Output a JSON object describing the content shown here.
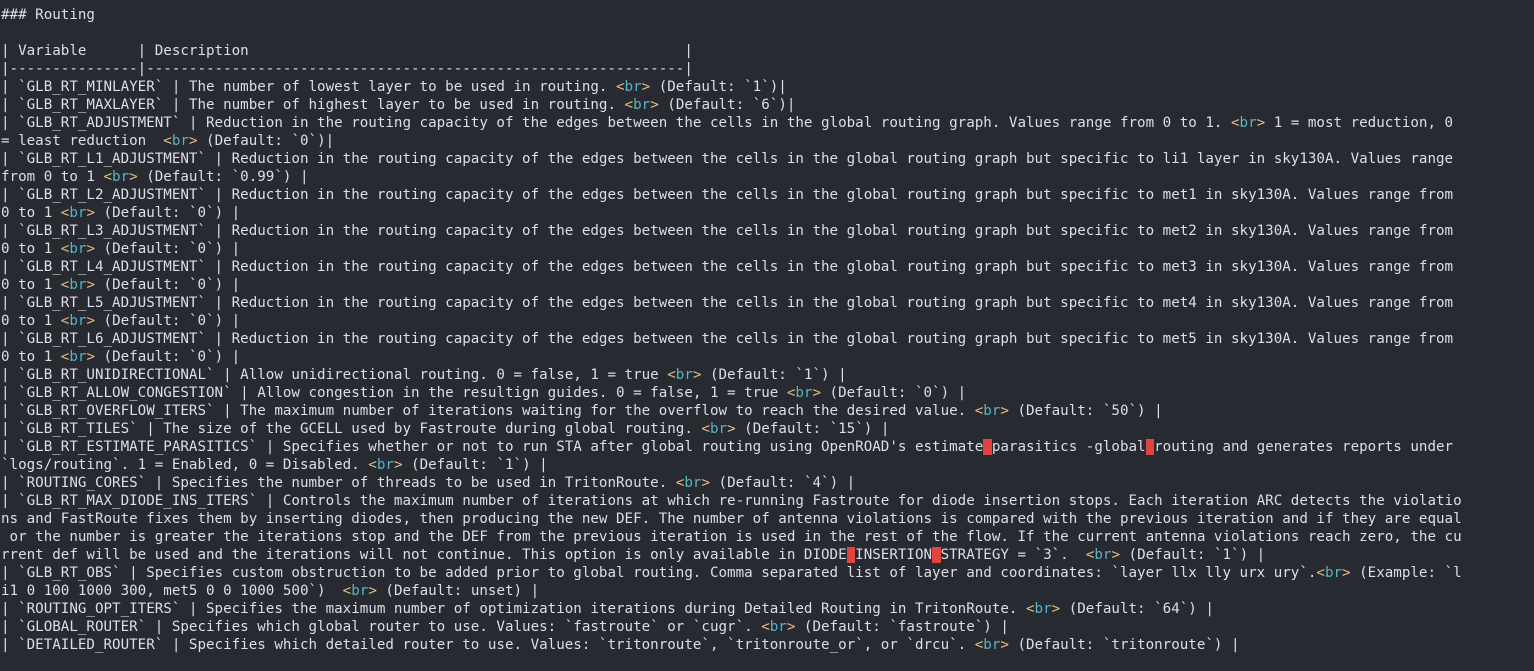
{
  "editor": {
    "background": "#272a30",
    "text_color": "#dcdfe4",
    "tag_color": "#56b6c2",
    "bracket_color": "#e5c07b",
    "highlight_color": "#e0443c"
  },
  "lines": [
    [
      {
        "t": "### Routing"
      }
    ],
    [
      {
        "t": ""
      }
    ],
    [
      {
        "t": "| Variable      | Description                                                   |"
      }
    ],
    [
      {
        "t": "|---------------|---------------------------------------------------------------|"
      }
    ],
    [
      {
        "t": "| `GLB_RT_MINLAYER` | The number of lowest layer to be used in routing. "
      },
      {
        "t": "<br>",
        "c": "br"
      },
      {
        "t": " (Default: `1`)|"
      }
    ],
    [
      {
        "t": "| `GLB_RT_MAXLAYER` | The number of highest layer to be used in routing. "
      },
      {
        "t": "<br>",
        "c": "br"
      },
      {
        "t": " (Default: `6`)|"
      }
    ],
    [
      {
        "t": "| `GLB_RT_ADJUSTMENT` | Reduction in the routing capacity of the edges between the cells in the global routing graph. Values range from 0 to 1. "
      },
      {
        "t": "<br>",
        "c": "br"
      },
      {
        "t": " 1 = most reduction, 0"
      }
    ],
    [
      {
        "t": "= least reduction  "
      },
      {
        "t": "<br>",
        "c": "br"
      },
      {
        "t": " (Default: `0`)|"
      }
    ],
    [
      {
        "t": "| `GLB_RT_L1_ADJUSTMENT` | Reduction in the routing capacity of the edges between the cells in the global routing graph but specific to li1 layer in sky130A. Values range"
      }
    ],
    [
      {
        "t": "from 0 to 1 "
      },
      {
        "t": "<br>",
        "c": "br"
      },
      {
        "t": " (Default: `0.99`) |"
      }
    ],
    [
      {
        "t": "| `GLB_RT_L2_ADJUSTMENT` | Reduction in the routing capacity of the edges between the cells in the global routing graph but specific to met1 in sky130A. Values range from"
      }
    ],
    [
      {
        "t": "0 to 1 "
      },
      {
        "t": "<br>",
        "c": "br"
      },
      {
        "t": " (Default: `0`) |"
      }
    ],
    [
      {
        "t": "| `GLB_RT_L3_ADJUSTMENT` | Reduction in the routing capacity of the edges between the cells in the global routing graph but specific to met2 in sky130A. Values range from"
      }
    ],
    [
      {
        "t": "0 to 1 "
      },
      {
        "t": "<br>",
        "c": "br"
      },
      {
        "t": " (Default: `0`) |"
      }
    ],
    [
      {
        "t": "| `GLB_RT_L4_ADJUSTMENT` | Reduction in the routing capacity of the edges between the cells in the global routing graph but specific to met3 in sky130A. Values range from"
      }
    ],
    [
      {
        "t": "0 to 1 "
      },
      {
        "t": "<br>",
        "c": "br"
      },
      {
        "t": " (Default: `0`) |"
      }
    ],
    [
      {
        "t": "| `GLB_RT_L5_ADJUSTMENT` | Reduction in the routing capacity of the edges between the cells in the global routing graph but specific to met4 in sky130A. Values range from"
      }
    ],
    [
      {
        "t": "0 to 1 "
      },
      {
        "t": "<br>",
        "c": "br"
      },
      {
        "t": " (Default: `0`) |"
      }
    ],
    [
      {
        "t": "| `GLB_RT_L6_ADJUSTMENT` | Reduction in the routing capacity of the edges between the cells in the global routing graph but specific to met5 in sky130A. Values range from"
      }
    ],
    [
      {
        "t": "0 to 1 "
      },
      {
        "t": "<br>",
        "c": "br"
      },
      {
        "t": " (Default: `0`) |"
      }
    ],
    [
      {
        "t": "| `GLB_RT_UNIDIRECTIONAL` | Allow unidirectional routing. 0 = false, 1 = true "
      },
      {
        "t": "<br>",
        "c": "br"
      },
      {
        "t": " (Default: `1`) |"
      }
    ],
    [
      {
        "t": "| `GLB_RT_ALLOW_CONGESTION` | Allow congestion in the resultign guides. 0 = false, 1 = true "
      },
      {
        "t": "<br>",
        "c": "br"
      },
      {
        "t": " (Default: `0`) |"
      }
    ],
    [
      {
        "t": "| `GLB_RT_OVERFLOW_ITERS` | The maximum number of iterations waiting for the overflow to reach the desired value. "
      },
      {
        "t": "<br>",
        "c": "br"
      },
      {
        "t": " (Default: `50`) |"
      }
    ],
    [
      {
        "t": "| `GLB_RT_TILES` | The size of the GCELL used by Fastroute during global routing. "
      },
      {
        "t": "<br>",
        "c": "br"
      },
      {
        "t": " (Default: `15`) |"
      }
    ],
    [
      {
        "t": "| `GLB_RT_ESTIMATE_PARASITICS` | Specifies whether or not to run STA after global routing using OpenROAD's estimate"
      },
      {
        "t": "_",
        "c": "hl"
      },
      {
        "t": "parasitics -global"
      },
      {
        "t": "_",
        "c": "hl"
      },
      {
        "t": "routing and generates reports under"
      }
    ],
    [
      {
        "t": "`logs/routing`. 1 = Enabled, 0 = Disabled. "
      },
      {
        "t": "<br>",
        "c": "br"
      },
      {
        "t": " (Default: `1`) |"
      }
    ],
    [
      {
        "t": "| `ROUTING_CORES` | Specifies the number of threads to be used in TritonRoute. "
      },
      {
        "t": "<br>",
        "c": "br"
      },
      {
        "t": " (Default: `4`) |"
      }
    ],
    [
      {
        "t": "| `GLB_RT_MAX_DIODE_INS_ITERS` | Controls the maximum number of iterations at which re-running Fastroute for diode insertion stops. Each iteration ARC detects the violatio"
      }
    ],
    [
      {
        "t": "ns and FastRoute fixes them by inserting diodes, then producing the new DEF. The number of antenna violations is compared with the previous iteration and if they are equal"
      }
    ],
    [
      {
        "t": " or the number is greater the iterations stop and the DEF from the previous iteration is used in the rest of the flow. If the current antenna violations reach zero, the cu"
      }
    ],
    [
      {
        "t": "rrent def will be used and the iterations will not continue. This option is only available in DIODE"
      },
      {
        "t": "_",
        "c": "hl"
      },
      {
        "t": "INSERTION"
      },
      {
        "t": "_",
        "c": "hl"
      },
      {
        "t": "STRATEGY = `3`.  "
      },
      {
        "t": "<br>",
        "c": "br"
      },
      {
        "t": " (Default: `1`) |"
      }
    ],
    [
      {
        "t": "| `GLB_RT_OBS` | Specifies custom obstruction to be added prior to global routing. Comma separated list of layer and coordinates: `layer llx lly urx ury`."
      },
      {
        "t": "<br>",
        "c": "br"
      },
      {
        "t": " (Example: `l"
      }
    ],
    [
      {
        "t": "i1 0 100 1000 300, met5 0 0 1000 500`)  "
      },
      {
        "t": "<br>",
        "c": "br"
      },
      {
        "t": " (Default: unset) |"
      }
    ],
    [
      {
        "t": "| `ROUTING_OPT_ITERS` | Specifies the maximum number of optimization iterations during Detailed Routing in TritonRoute. "
      },
      {
        "t": "<br>",
        "c": "br"
      },
      {
        "t": " (Default: `64`) |"
      }
    ],
    [
      {
        "t": "| `GLOBAL_ROUTER` | Specifies which global router to use. Values: `fastroute` or `cugr`. "
      },
      {
        "t": "<br>",
        "c": "br"
      },
      {
        "t": " (Default: `fastroute`) |"
      }
    ],
    [
      {
        "t": "| `DETAILED_ROUTER` | Specifies which detailed router to use. Values: `tritonroute`, `tritonroute_or`, or `drcu`. "
      },
      {
        "t": "<br>",
        "c": "br"
      },
      {
        "t": " (Default: `tritonroute`) |"
      }
    ]
  ]
}
